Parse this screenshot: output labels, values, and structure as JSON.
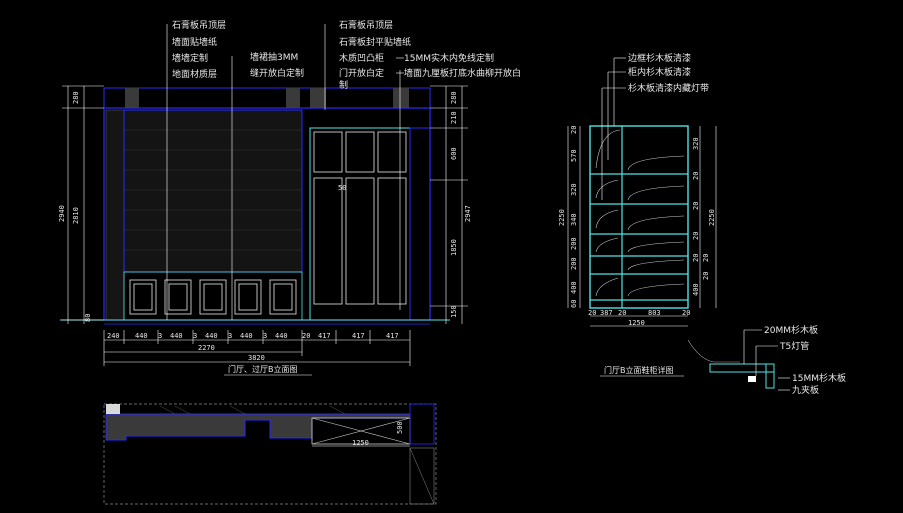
{
  "colors": {
    "background": "#000000",
    "outline": "#2a2aff",
    "detail": "#4fe3e3",
    "text": "#e8e8e8",
    "leader": "#ffffff"
  },
  "annotations_left": [
    "石膏板吊顶层",
    "墙面贴墙纸",
    "墙墙定制",
    "地面材质层"
  ],
  "annotation_left_extra": [
    "墙裙抽3MM",
    "缝开放白定制"
  ],
  "annotations_mid": [
    "石膏板吊顶层",
    "石膏板封平贴墙纸",
    "木质凹凸柜",
    "门开放白定",
    "制"
  ],
  "annotation_mid_right": [
    "15MM实木内免线定制",
    "墙面九厘板打底水曲柳开放白"
  ],
  "annotations_right": [
    "边框杉木板清漆",
    "柜内杉木板清漆",
    "杉木板清漆内藏灯带"
  ],
  "detail_labels": [
    "20MM杉木板",
    "T5灯管",
    "15MM杉木板",
    "九夹板"
  ],
  "titles": {
    "elevation": "门厅、过厅B立面图",
    "cabinet": "门厅B立面鞋柜详图"
  },
  "dims_bottom": [
    "240",
    "440",
    "3",
    "440",
    "3",
    "440",
    "3",
    "440",
    "3",
    "440",
    "20",
    "417",
    "417",
    "417"
  ],
  "dims_total_1": "2270",
  "dims_total_2": "3820",
  "dims_left": [
    "280",
    "2810",
    "2940",
    "80"
  ],
  "dims_right": [
    "280",
    "210",
    "600",
    "1850",
    "2947",
    "150"
  ],
  "cabinet_dims_left": [
    "20",
    "570",
    "320",
    "340",
    "200",
    "200",
    "400",
    "60",
    "2250"
  ],
  "cabinet_dims_right": [
    "320",
    "20",
    "20",
    "20",
    "20",
    "2250",
    "20",
    "20",
    "400"
  ],
  "cabinet_dims_bottom": [
    "20",
    "387",
    "20",
    "803",
    "20"
  ],
  "cabinet_total": "1250",
  "mark_50": "50",
  "plan_dim_1250": "1250",
  "plan_dim_500": "500"
}
